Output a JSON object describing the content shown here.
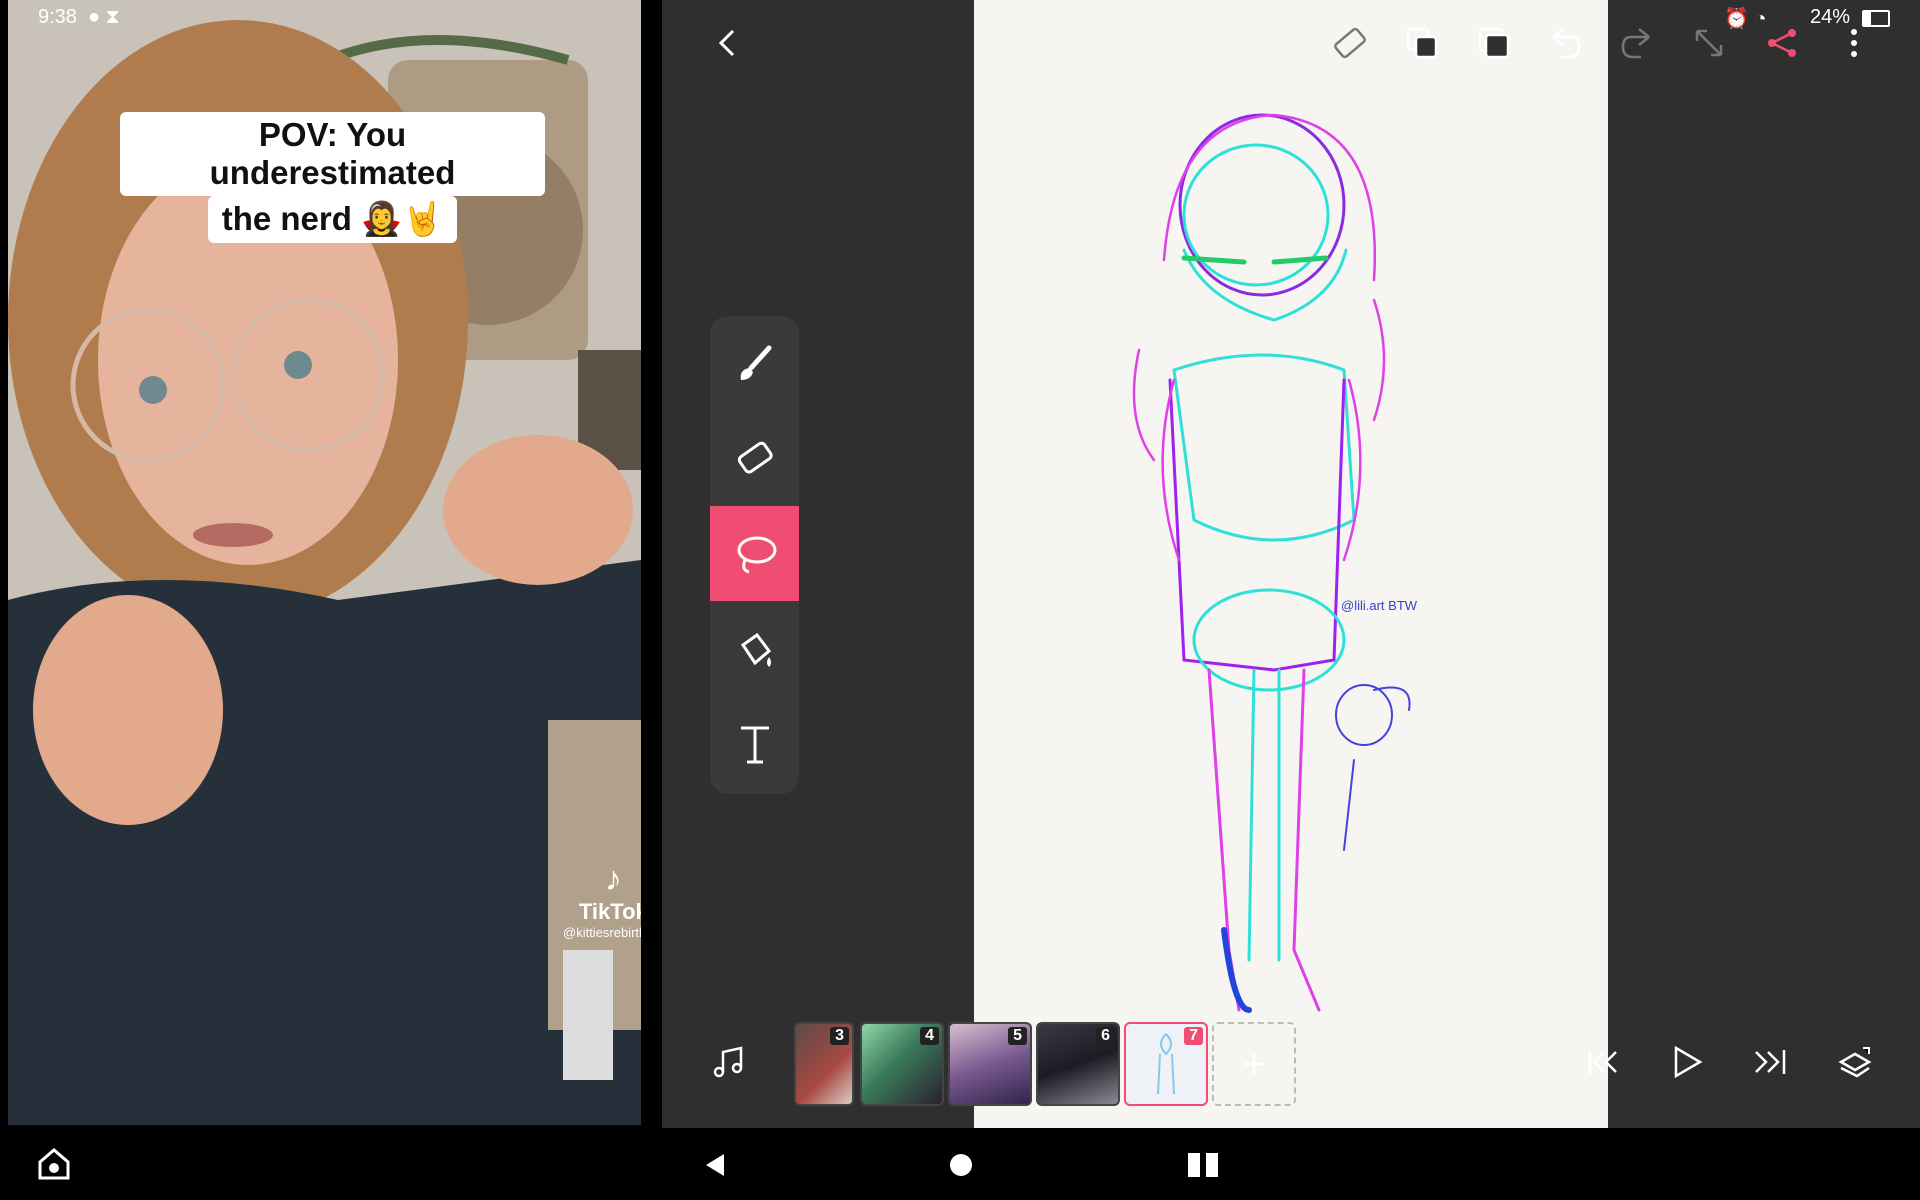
{
  "status_bar": {
    "time": "9:38",
    "battery": "24%"
  },
  "video": {
    "caption_line1": "POV: You underestimated",
    "caption_line2": "the nerd 🧛‍♀️🤘",
    "watermark_brand": "TikTok",
    "watermark_handle": "@kittiesrebirthing"
  },
  "app": {
    "top_icons": [
      "back-icon",
      "ruler-icon",
      "copy-layer-icon",
      "layers-icon",
      "undo-icon",
      "redo-icon",
      "fullscreen-icon",
      "share-icon",
      "more-icon"
    ],
    "tools": [
      {
        "name": "brush",
        "icon": "brush-icon"
      },
      {
        "name": "eraser",
        "icon": "eraser-icon"
      },
      {
        "name": "lasso",
        "icon": "lasso-icon",
        "active": true
      },
      {
        "name": "fill",
        "icon": "fill-bucket-icon"
      },
      {
        "name": "text",
        "icon": "text-icon"
      }
    ],
    "frames": [
      {
        "number": "3"
      },
      {
        "number": "4"
      },
      {
        "number": "5"
      },
      {
        "number": "6"
      },
      {
        "number": "7",
        "selected": true
      }
    ],
    "accent_color": "#f04d73",
    "canvas_signature": "@lili.art BTW"
  }
}
